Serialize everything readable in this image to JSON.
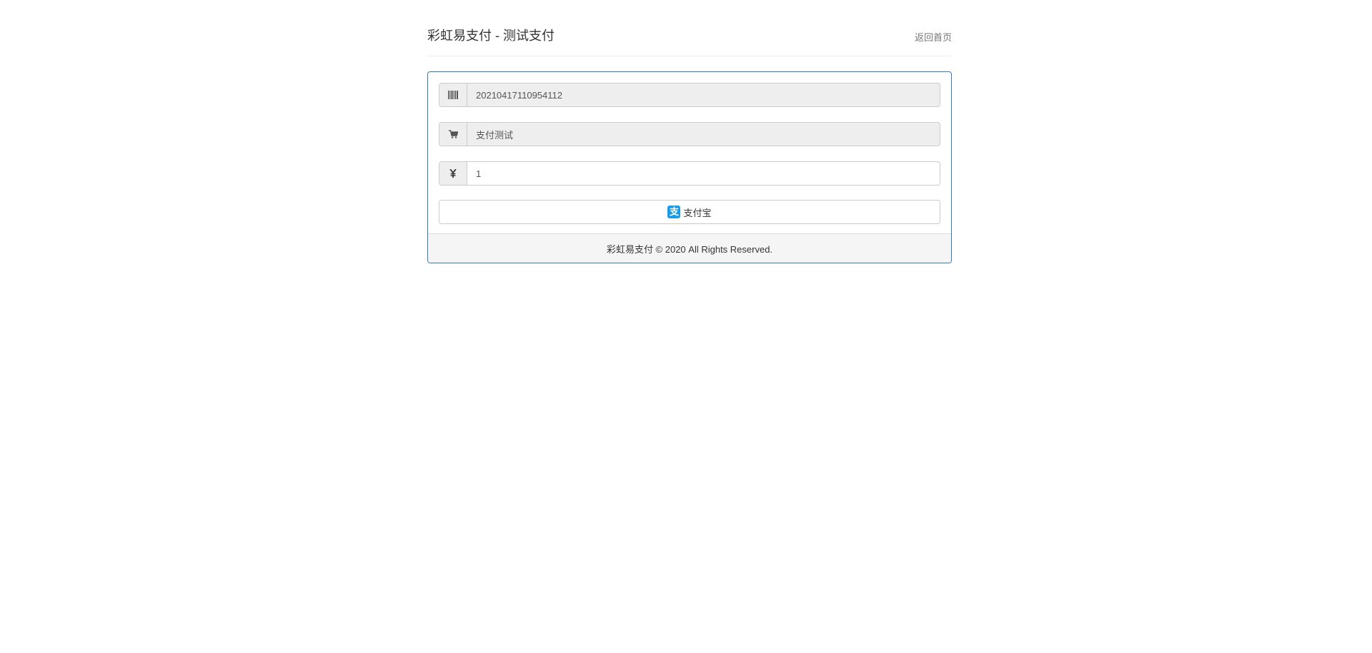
{
  "header": {
    "title": "彩虹易支付 - 测试支付",
    "home_link": "返回首页"
  },
  "form": {
    "order_no": {
      "icon": "barcode-icon",
      "value": "20210417110954112"
    },
    "product_name": {
      "icon": "cart-icon",
      "value": "支付测试"
    },
    "amount": {
      "icon": "yen-icon",
      "value": "1"
    },
    "pay_button": {
      "icon": "alipay-icon",
      "icon_glyph": "支",
      "label": "支付宝"
    }
  },
  "footer": {
    "text": "彩虹易支付 © 2020 All Rights Reserved."
  },
  "colors": {
    "panel_border": "#337ab7",
    "alipay_blue": "#1a9be6"
  }
}
